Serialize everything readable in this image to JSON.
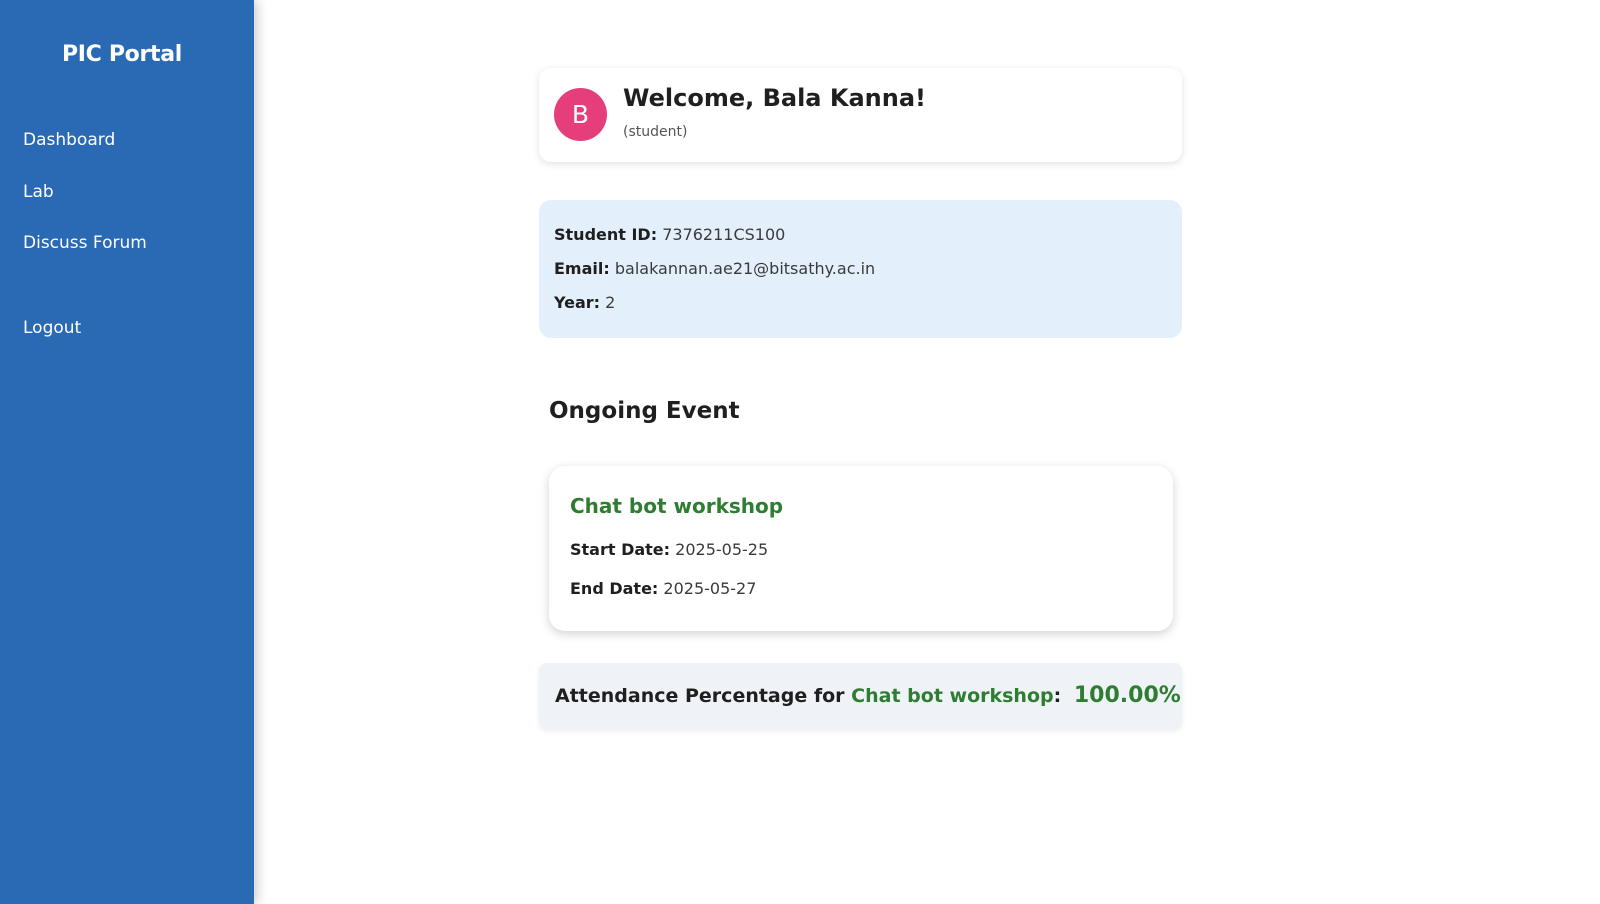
{
  "sidebar": {
    "brand": "PIC Portal",
    "items": [
      {
        "label": "Dashboard"
      },
      {
        "label": "Lab"
      },
      {
        "label": "Discuss Forum"
      }
    ],
    "logout_label": "Logout"
  },
  "profile": {
    "avatar_letter": "B",
    "welcome": "Welcome, Bala Kanna!",
    "role": "(student)",
    "avatar_color": "#e63d7b"
  },
  "details": {
    "student_id_label": "Student ID:",
    "student_id": "7376211CS100",
    "email_label": "Email:",
    "email": "balakannan.ae21@bitsathy.ac.in",
    "year_label": "Year:",
    "year": "2"
  },
  "ongoing": {
    "title": "Ongoing Event",
    "event_name": "Chat bot workshop",
    "start_label": "Start Date:",
    "start_date": "2025-05-25",
    "end_label": "End Date:",
    "end_date": "2025-05-27"
  },
  "attendance": {
    "prefix": "Attendance Percentage for",
    "event_name": "Chat bot workshop",
    "colon": ":",
    "value": "100.00%"
  },
  "colors": {
    "sidebar": "#2a69b4",
    "accent_green": "#2e7d32",
    "info_bg": "#e3f0fc"
  }
}
